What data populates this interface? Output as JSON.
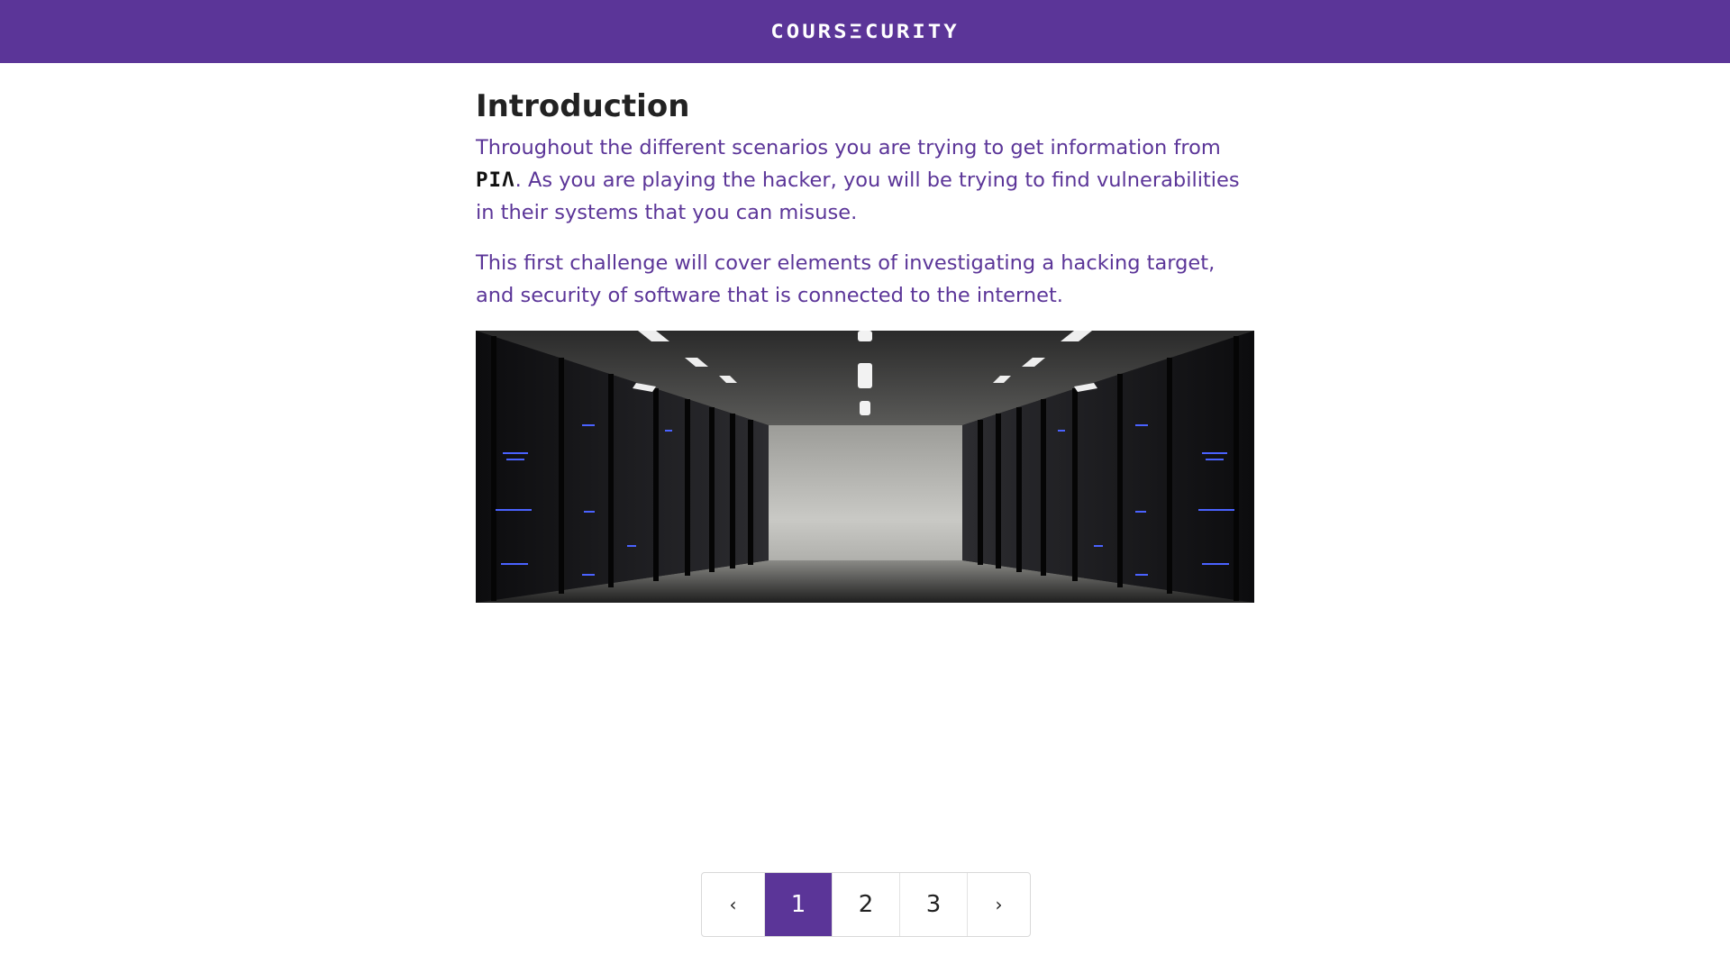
{
  "header": {
    "logo_text": "COURSΞCURITY",
    "background_color": "#5b3598"
  },
  "main": {
    "title": "Introduction",
    "paragraph1_before": "Throughout the different scenarios you are trying to get information from ",
    "brand_inline": "PIΛ",
    "paragraph1_after": ". As you are playing the hacker, you will be trying to find vulnerabilities in their systems that you can misuse.",
    "paragraph2": "This first challenge will cover elements of investigating a hacking target, and security of software that is connected to the internet.",
    "text_color": "#5b3598"
  },
  "pagination": {
    "prev_label": "‹",
    "pages": [
      "1",
      "2",
      "3"
    ],
    "active_page": "1",
    "next_label": "›"
  }
}
